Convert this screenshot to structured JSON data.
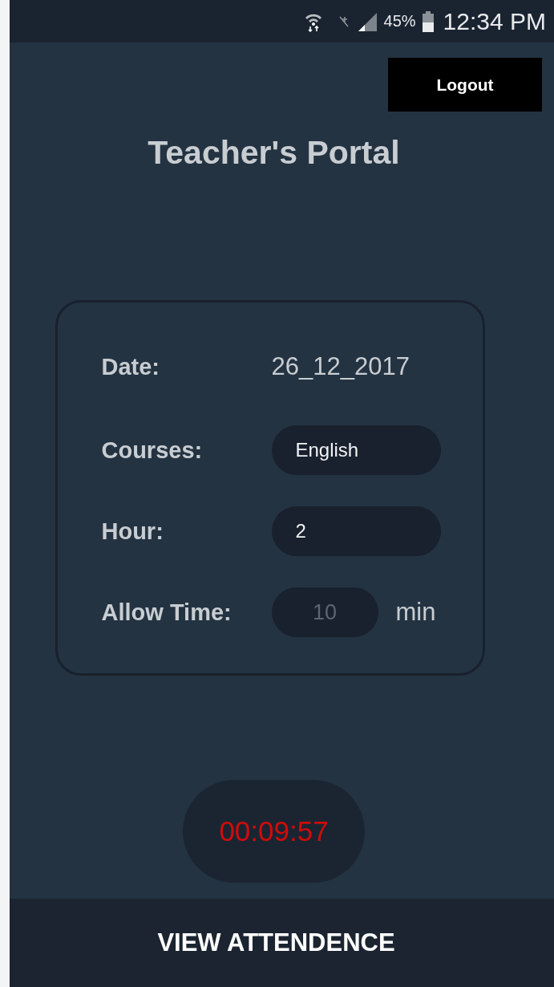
{
  "status_bar": {
    "battery": "45%",
    "time": "12:34 PM"
  },
  "logout_button": "Logout",
  "title": "Teacher's Portal",
  "form": {
    "rows": [
      {
        "kind": "text",
        "label": "Date:",
        "value": "26_12_2017"
      },
      {
        "kind": "field",
        "label": "Courses:",
        "value": "English"
      },
      {
        "kind": "field",
        "label": "Hour:",
        "value": "2"
      },
      {
        "kind": "unit_field",
        "label": "Allow Time:",
        "placeholder": "10",
        "unit": "min"
      }
    ]
  },
  "timer": "00:09:57",
  "bottom_button": "VIEW ATTENDENCE"
}
